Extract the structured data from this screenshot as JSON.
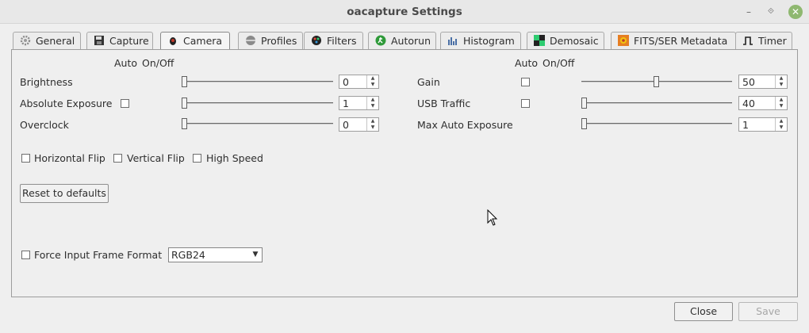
{
  "window": {
    "title": "oacapture Settings",
    "minimize_glyph": "–",
    "maximize_glyph": "⟐",
    "close_glyph": "✕"
  },
  "tabs": [
    {
      "label": "General",
      "icon": "gear-icon"
    },
    {
      "label": "Capture",
      "icon": "floppy-disk-icon"
    },
    {
      "label": "Camera",
      "icon": "camera-icon",
      "active": true
    },
    {
      "label": "Profiles",
      "icon": "disc-icon"
    },
    {
      "label": "Filters",
      "icon": "color-wheel-icon"
    },
    {
      "label": "Autorun",
      "icon": "runner-icon"
    },
    {
      "label": "Histogram",
      "icon": "histogram-icon"
    },
    {
      "label": "Demosaic",
      "icon": "bayer-grid-icon"
    },
    {
      "label": "FITS/SER Metadata",
      "icon": "image-metadata-icon"
    },
    {
      "label": "Timer",
      "icon": "pulse-icon"
    }
  ],
  "camera": {
    "header_auto": "Auto",
    "header_onoff": "On/Off",
    "left_controls": [
      {
        "label": "Brightness",
        "value": "0",
        "has_auto": false
      },
      {
        "label": "Absolute Exposure",
        "value": "1",
        "has_auto": true
      },
      {
        "label": "Overclock",
        "value": "0",
        "has_auto": false
      }
    ],
    "right_controls": [
      {
        "label": "Gain",
        "value": "50",
        "has_auto": true
      },
      {
        "label": "USB Traffic",
        "value": "40",
        "has_auto": true
      },
      {
        "label": "Max Auto Exposure",
        "value": "1",
        "has_auto": false
      }
    ],
    "flips": {
      "horizontal": "Horizontal Flip",
      "vertical": "Vertical Flip",
      "high_speed": "High Speed"
    },
    "reset_button": "Reset to defaults",
    "force_format": {
      "label": "Force Input Frame Format",
      "selected": "RGB24"
    }
  },
  "footer": {
    "close_button": "Close",
    "save_button": "Save"
  },
  "colors": {
    "accent_close": "#8fb870",
    "panel_bg": "#efefef"
  }
}
